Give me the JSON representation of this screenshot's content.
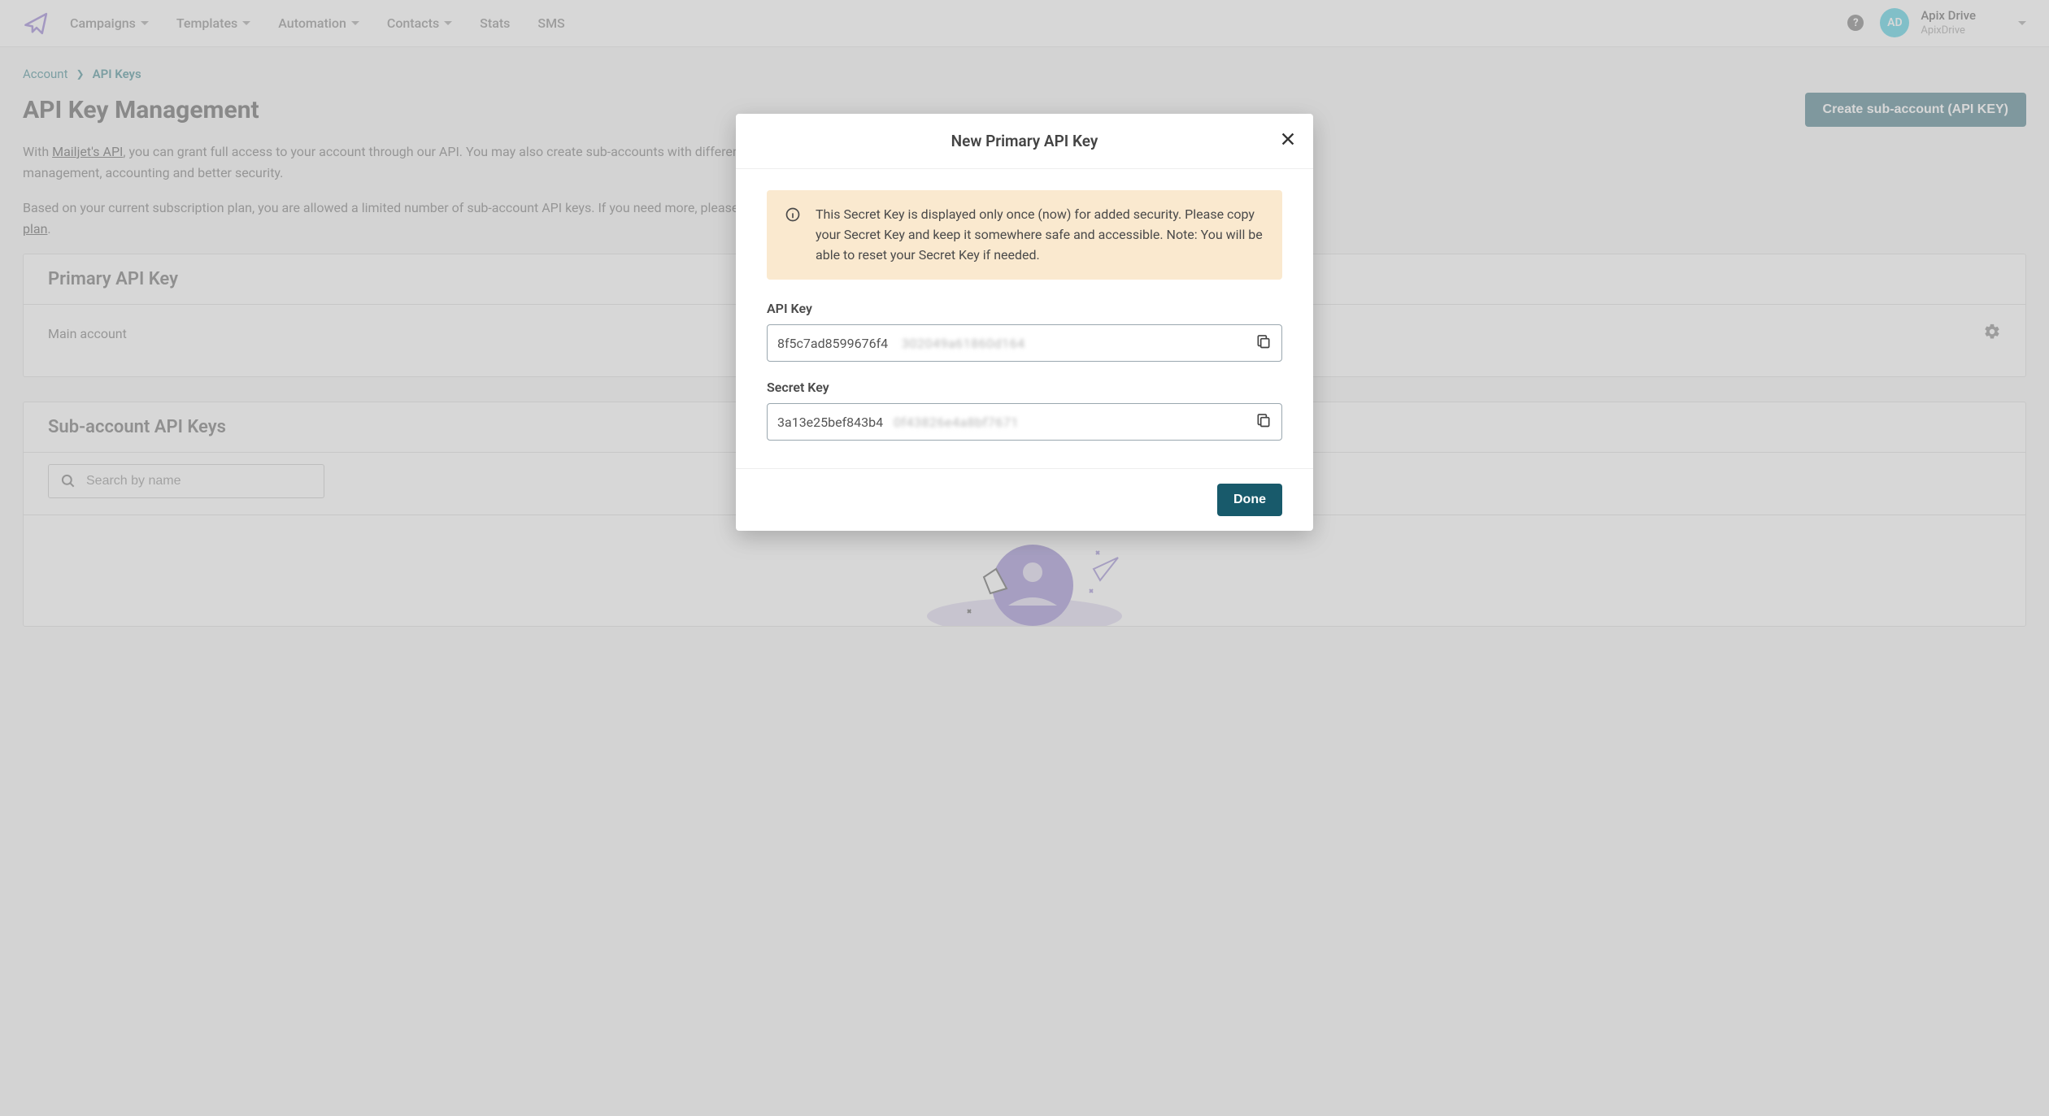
{
  "nav": {
    "items": [
      "Campaigns",
      "Templates",
      "Automation",
      "Contacts",
      "Stats",
      "SMS"
    ]
  },
  "user": {
    "initials": "AD",
    "name": "Apix Drive",
    "sub": "ApixDrive"
  },
  "breadcrumb": {
    "root": "Account",
    "current": "API Keys"
  },
  "page": {
    "title": "API Key Management",
    "create_button": "Create sub-account (API KEY)",
    "desc_prefix": "With ",
    "desc_link": "Mailjet's API",
    "desc_rest": ", you can grant full access to your account through our API. You may also create sub-accounts with different API keys for easier management, accounting and better security.",
    "desc2_prefix": "Based on your current subscription plan, you are allowed a limited number of sub-account API keys. If you need more, please ",
    "desc2_link": "upgrade your subscription plan",
    "desc2_suffix": "."
  },
  "primary_card": {
    "title": "Primary API Key",
    "row": "Main account"
  },
  "sub_card": {
    "title": "Sub-account API Keys",
    "search_placeholder": "Search by name"
  },
  "modal": {
    "title": "New Primary API Key",
    "alert": "This Secret Key is displayed only once (now) for added security. Please copy your Secret Key and keep it somewhere safe and accessible. Note: You will be able to reset your Secret Key if needed.",
    "api_key_label": "API Key",
    "api_key_value": "8f5c7ad8599676f4",
    "api_key_tail": "302049a61860d164",
    "secret_label": "Secret Key",
    "secret_value": "3a13e25bef843b4",
    "secret_tail": "0f43826e4a8bf7671",
    "done": "Done"
  }
}
